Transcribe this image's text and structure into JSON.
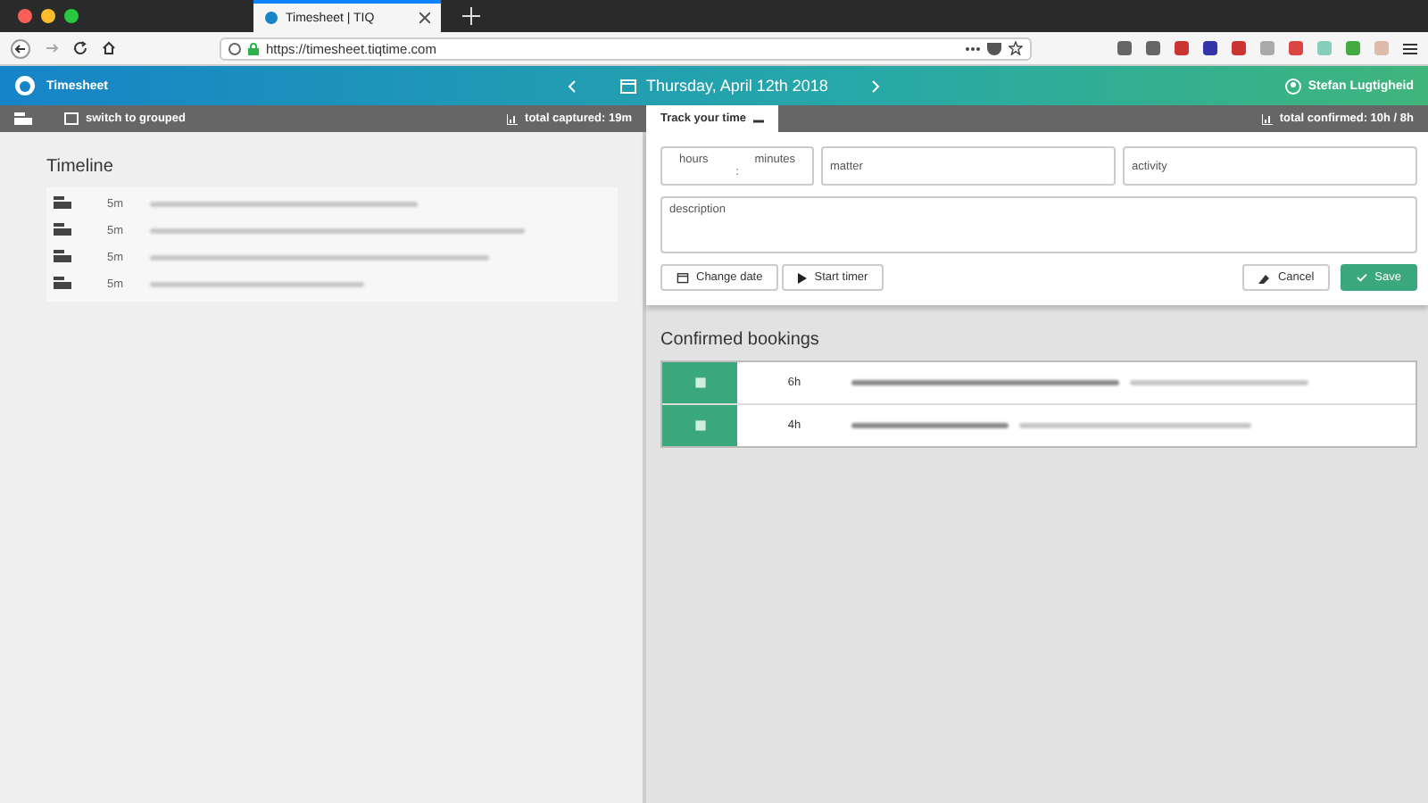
{
  "browser": {
    "tab_title": "Timesheet | TIQ",
    "url": "https://timesheet.tiqtime.com"
  },
  "header": {
    "app_name": "Timesheet",
    "date": "Thursday, April 12th 2018",
    "user": "Stefan Lugtigheid"
  },
  "subbar": {
    "switch_label": "switch to grouped",
    "captured": "total captured: 19m",
    "track_label": "Track your time",
    "confirmed": "total confirmed: 10h / 8h"
  },
  "timeline": {
    "title": "Timeline",
    "entries": [
      {
        "duration": "5m"
      },
      {
        "duration": "5m"
      },
      {
        "duration": "5m"
      },
      {
        "duration": "5m"
      }
    ]
  },
  "form": {
    "hours_placeholder": "hours",
    "minutes_placeholder": "minutes",
    "separator": ":",
    "matter_placeholder": "matter",
    "activity_placeholder": "activity",
    "description_placeholder": "description",
    "change_date": "Change date",
    "start_timer": "Start timer",
    "cancel": "Cancel",
    "save": "Save"
  },
  "confirmed": {
    "title": "Confirmed bookings",
    "bookings": [
      {
        "duration": "6h"
      },
      {
        "duration": "4h"
      }
    ]
  }
}
